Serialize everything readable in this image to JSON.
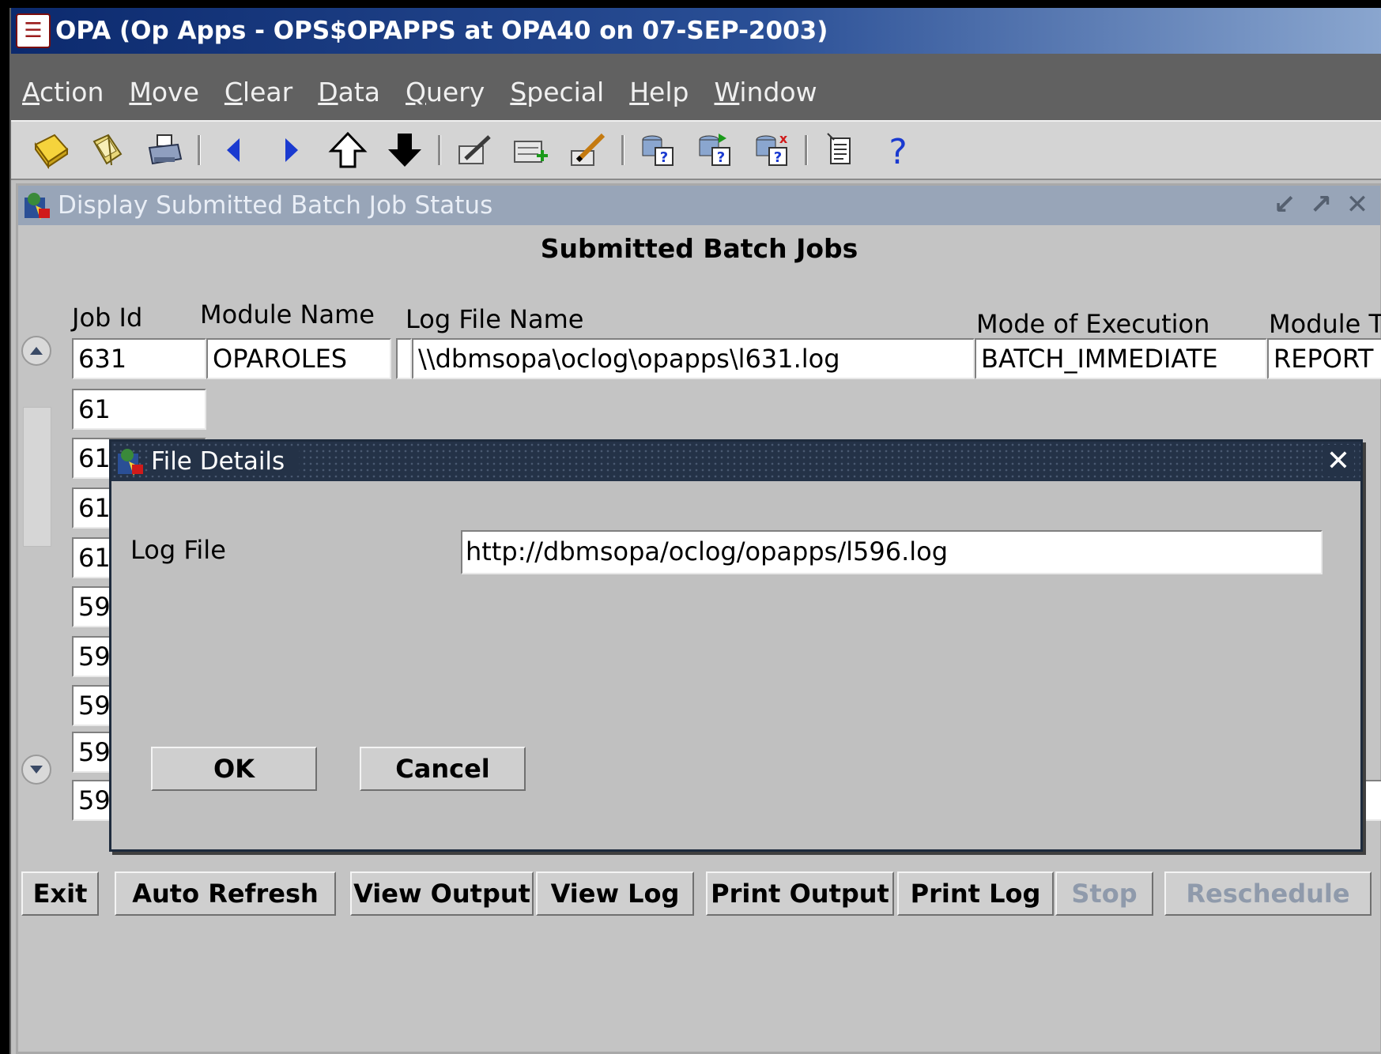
{
  "app": {
    "title": "OPA (Op Apps - OPS$OPAPPS at OPA40 on 07-SEP-2003)"
  },
  "menu": {
    "items": [
      {
        "label": "Action",
        "mnemonic": "A"
      },
      {
        "label": "Move",
        "mnemonic": "M"
      },
      {
        "label": "Clear",
        "mnemonic": "C"
      },
      {
        "label": "Data",
        "mnemonic": "D"
      },
      {
        "label": "Query",
        "mnemonic": "Q"
      },
      {
        "label": "Special",
        "mnemonic": "S"
      },
      {
        "label": "Help",
        "mnemonic": "H"
      },
      {
        "label": "Window",
        "mnemonic": "W"
      }
    ]
  },
  "toolbar": {
    "icons": [
      "save-icon",
      "open-icon",
      "print-icon",
      "previous-record-icon",
      "next-record-icon",
      "previous-block-icon",
      "next-block-icon",
      "edit-icon",
      "insert-record-icon",
      "pencil-icon",
      "enter-query-icon",
      "execute-query-icon",
      "cancel-query-icon",
      "list-icon",
      "help-icon"
    ]
  },
  "window": {
    "title": "Display Submitted Batch Job Status",
    "heading": "Submitted Batch Jobs",
    "columns": {
      "job_id": "Job Id",
      "module_name": "Module Name",
      "log_file": "Log File Name",
      "mode": "Mode  of Execution",
      "module_type": "Module T"
    },
    "rows": [
      {
        "job_id": "631",
        "module_name": "OPAROLES",
        "log_file": "\\\\dbmsopa\\oclog\\opapps\\l631.log",
        "mode": "BATCH_IMMEDIATE",
        "module_type": "REPORT"
      },
      {
        "job_id": "61"
      },
      {
        "job_id": "61"
      },
      {
        "job_id": "61"
      },
      {
        "job_id": "61"
      },
      {
        "job_id": "59"
      },
      {
        "job_id": "59"
      },
      {
        "job_id": "59"
      },
      {
        "job_id": "59"
      },
      {
        "job_id": "59"
      }
    ],
    "buttons": {
      "exit": "Exit",
      "auto_refresh": "Auto Refresh",
      "view_output": "View Output",
      "view_log": "View Log",
      "print_output": "Print Output",
      "print_log": "Print Log",
      "stop": "Stop",
      "reschedule": "Reschedule"
    }
  },
  "dialog": {
    "title": "File Details",
    "log_file_label": "Log File",
    "log_file_value": "http://dbmsopa/oclog/opapps/l596.log",
    "ok": "OK",
    "cancel": "Cancel"
  },
  "colors": {
    "title_bar": "#0c2a6e",
    "menu_bar": "#616161",
    "dialog_title": "#243247",
    "disabled_text": "#8f9aab"
  }
}
